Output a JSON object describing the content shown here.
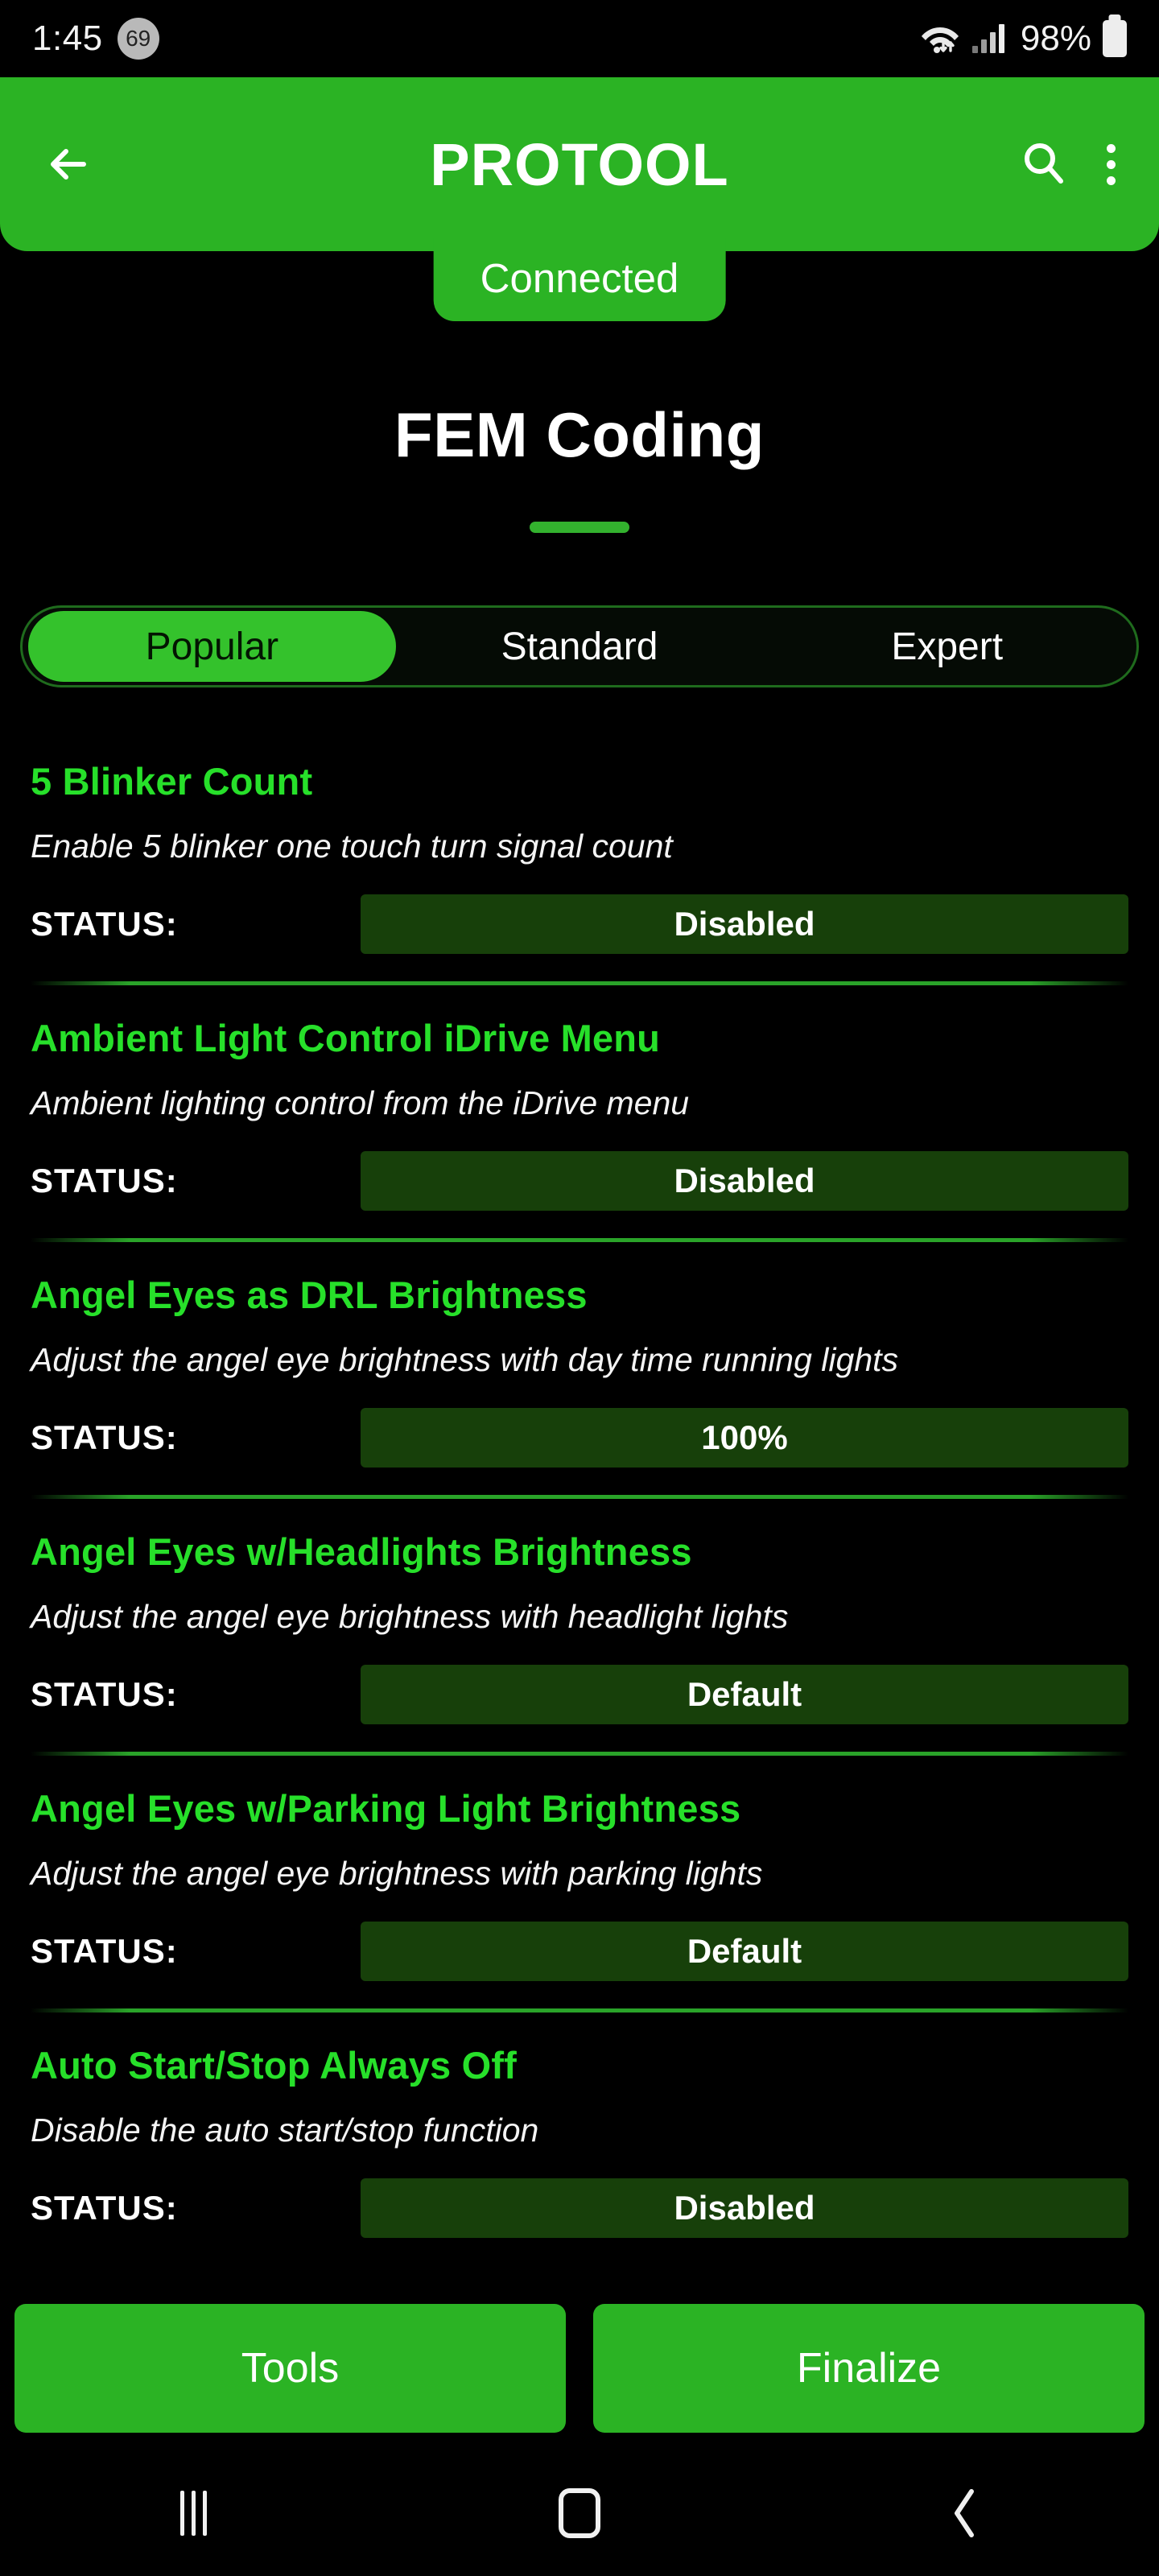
{
  "status_bar": {
    "time": "1:45",
    "notification_count": "69",
    "wifi_icon": "wifi-icon",
    "signal_icon": "cellular-signal-icon",
    "battery_percent": "98%",
    "battery_icon": "battery-icon"
  },
  "app_bar": {
    "back_icon": "back-arrow-icon",
    "title": "PROTOOL",
    "search_icon": "search-icon",
    "menu_icon": "overflow-menu-icon"
  },
  "connection": {
    "status": "Connected"
  },
  "page": {
    "title": "FEM Coding"
  },
  "tabs": {
    "items": [
      {
        "label": "Popular",
        "active": true
      },
      {
        "label": "Standard",
        "active": false
      },
      {
        "label": "Expert",
        "active": false
      }
    ]
  },
  "list": {
    "status_label": "STATUS:",
    "items": [
      {
        "name": "5 Blinker Count",
        "description": "Enable 5 blinker one touch turn signal count",
        "status": "Disabled"
      },
      {
        "name": "Ambient Light Control iDrive Menu",
        "description": "Ambient lighting control from the iDrive menu",
        "status": "Disabled"
      },
      {
        "name": "Angel Eyes as DRL Brightness",
        "description": "Adjust the angel eye brightness with day time running lights",
        "status": "100%"
      },
      {
        "name": "Angel Eyes w/Headlights Brightness",
        "description": "Adjust the angel eye brightness with headlight lights",
        "status": "Default"
      },
      {
        "name": "Angel Eyes w/Parking Light Brightness",
        "description": "Adjust the angel eye brightness with parking lights",
        "status": "Default"
      },
      {
        "name": "Auto Start/Stop Always Off",
        "description": "Disable the auto start/stop function",
        "status": "Disabled"
      }
    ]
  },
  "bottom_actions": {
    "tools_label": "Tools",
    "finalize_label": "Finalize"
  },
  "nav_bar": {
    "recents_icon": "recents-icon",
    "home_icon": "home-icon",
    "back_icon": "back-icon"
  },
  "colors": {
    "brand_green": "#2bb324",
    "accent_green": "#27e02a",
    "status_box_green": "#17400a",
    "tab_active_green": "#34c22c",
    "background": "#000000"
  }
}
